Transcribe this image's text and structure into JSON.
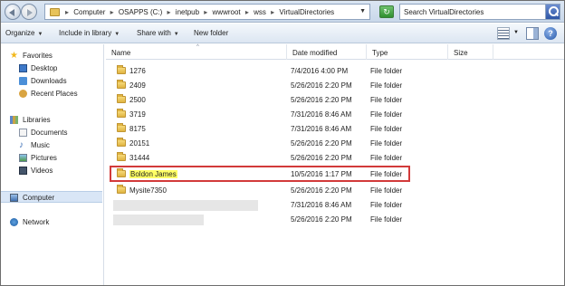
{
  "address": {
    "crumbs": [
      "Computer",
      "OSAPPS (C:)",
      "inetpub",
      "wwwroot",
      "wss",
      "VirtualDirectories"
    ],
    "separator": "▸"
  },
  "search": {
    "placeholder": "Search VirtualDirectories"
  },
  "toolbar": {
    "organize": "Organize",
    "include_in_library": "Include in library",
    "share_with": "Share with",
    "new_folder": "New folder",
    "caret": "▼",
    "help": "?"
  },
  "nav": {
    "favorites": "Favorites",
    "desktop": "Desktop",
    "downloads": "Downloads",
    "recent_places": "Recent Places",
    "libraries": "Libraries",
    "documents": "Documents",
    "music": "Music",
    "pictures": "Pictures",
    "videos": "Videos",
    "computer": "Computer",
    "network": "Network"
  },
  "columns": {
    "name": "Name",
    "date_modified": "Date modified",
    "type": "Type",
    "size": "Size",
    "sort_indicator": "^"
  },
  "files": [
    {
      "name": "1276",
      "date": "7/4/2016 4:00 PM",
      "type": "File folder"
    },
    {
      "name": "2409",
      "date": "5/26/2016 2:20 PM",
      "type": "File folder"
    },
    {
      "name": "2500",
      "date": "5/26/2016 2:20 PM",
      "type": "File folder"
    },
    {
      "name": "3719",
      "date": "7/31/2016 8:46 AM",
      "type": "File folder"
    },
    {
      "name": "8175",
      "date": "7/31/2016 8:46 AM",
      "type": "File folder"
    },
    {
      "name": "20151",
      "date": "5/26/2016 2:20 PM",
      "type": "File folder"
    },
    {
      "name": "31444",
      "date": "5/26/2016 2:20 PM",
      "type": "File folder"
    },
    {
      "name": "Boldon James",
      "date": "10/5/2016 1:17 PM",
      "type": "File folder"
    },
    {
      "name": "Mysite7350",
      "date": "5/26/2016 2:20 PM",
      "type": "File folder"
    },
    {
      "name": "",
      "date": "7/31/2016 8:46 AM",
      "type": "File folder"
    },
    {
      "name": "",
      "date": "5/26/2016 2:20 PM",
      "type": "File folder"
    }
  ],
  "colors": {
    "highlight_border": "#d23a3a",
    "highlight_text_bg": "#ffff66"
  }
}
